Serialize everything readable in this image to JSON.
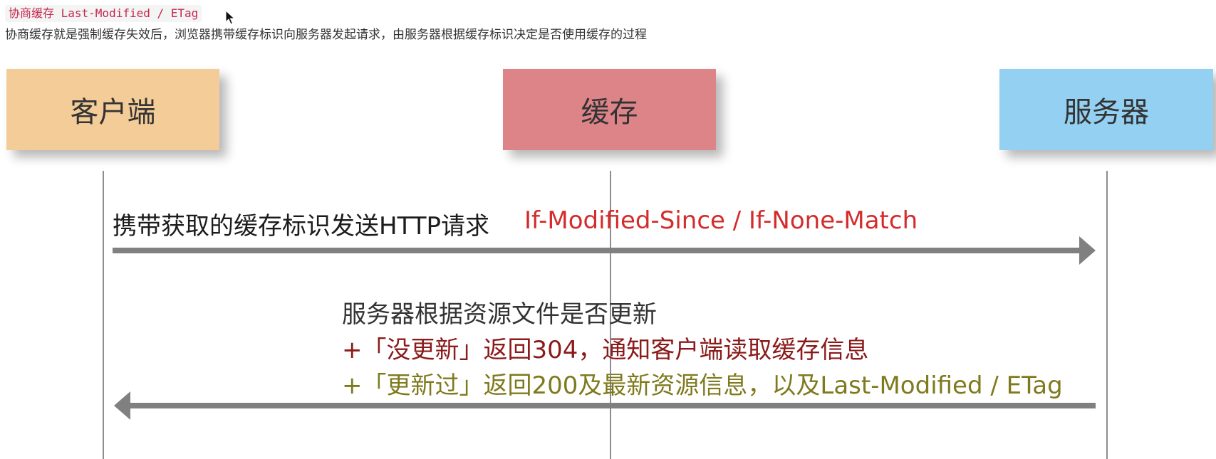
{
  "header": {
    "code_tag": "协商缓存 Last-Modified / ETag",
    "description": "协商缓存就是强制缓存失效后，浏览器携带缓存标识向服务器发起请求，由服务器根据缓存标识决定是否使用缓存的过程"
  },
  "actors": {
    "client": {
      "label": "客户端",
      "color": "#f4cc98"
    },
    "cache": {
      "label": "缓存",
      "color": "#dd8489"
    },
    "server": {
      "label": "服务器",
      "color": "#94d0f2"
    }
  },
  "request": {
    "label": "携带获取的缓存标识发送HTTP请求",
    "headers": "If-Modified-Since / If-None-Match",
    "headers_color": "#d42b2b"
  },
  "response": {
    "line1": "服务器根据资源文件是否更新",
    "line2": "+「没更新」返回304，通知客户端读取缓存信息",
    "line2_color": "#8b1a1a",
    "line3": "+「更新过」返回200及最新资源信息，以及Last-Modified / ETag",
    "line3_color": "#7f7a1e"
  },
  "colors": {
    "lifeline": "#8d8d8d",
    "arrow": "#808080",
    "text": "#333333"
  }
}
